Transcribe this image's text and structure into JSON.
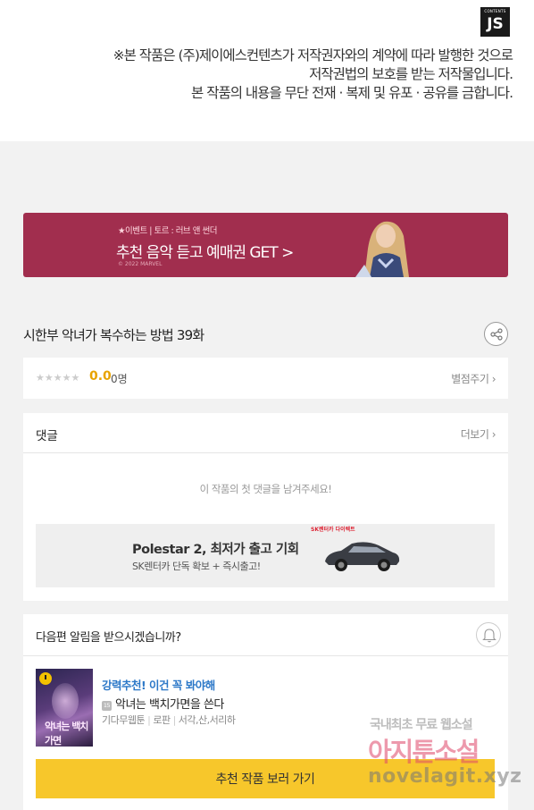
{
  "publisher_logo": {
    "text": "JS",
    "mini_text": "CONTENTS"
  },
  "notice": {
    "line1": "※본 작품은 (주)제이에스컨텐츠가 저작권자와의 계약에 따라 발행한 것으로",
    "line2": "저작권법의 보호를 받는 저작물입니다.",
    "line3": "본 작품의 내용을 무단 전재 · 복제 및 유포 · 공유를 금합니다."
  },
  "banner": {
    "small_text": "★이벤트 | 토르 : 러브 앤 썬더",
    "headline": "추천 음악 듣고 예매권 GET >",
    "copyright": "© 2022 MARVEL",
    "bg_color": "#a12e4e"
  },
  "episode": {
    "title": "시한부 악녀가 복수하는 방법 39화"
  },
  "rating": {
    "stars": "★★★★★",
    "score": "0.0",
    "count": "0명",
    "rate_link": "별점주기 ›"
  },
  "comments": {
    "label": "댓글",
    "more_link": "더보기 ›",
    "empty_message": "이 작품의 첫 댓글을 남겨주세요!"
  },
  "ad": {
    "logo_text": "SK렌터카 다이렉트",
    "title": "Polestar 2, 최저가 출고 기회",
    "subtitle": "SK렌터카 단독 확보 + 즉시출고!"
  },
  "notify": {
    "question": "다음편 알림을 받으시겠습니까?",
    "recommend_tag": "강력추천! 이건 꼭 봐야해",
    "age_badge": "15",
    "book_title": "악녀는 백치가면을 쓴다",
    "meta": [
      "기다무웹툰",
      "로판",
      "서각,산,서리하"
    ],
    "thumb_text": "악녀는 백치가면",
    "cta_label": "추천 작품 보러 가기",
    "cta_color": "#f7c72b"
  },
  "watermark": {
    "line1": "국내최초 무료 웹소설",
    "line2": "아지툰소설",
    "line3": "novelagit.xyz"
  },
  "icons": [
    "share-icon",
    "bell-icon",
    "clock-icon",
    "chevron-right-icon"
  ]
}
